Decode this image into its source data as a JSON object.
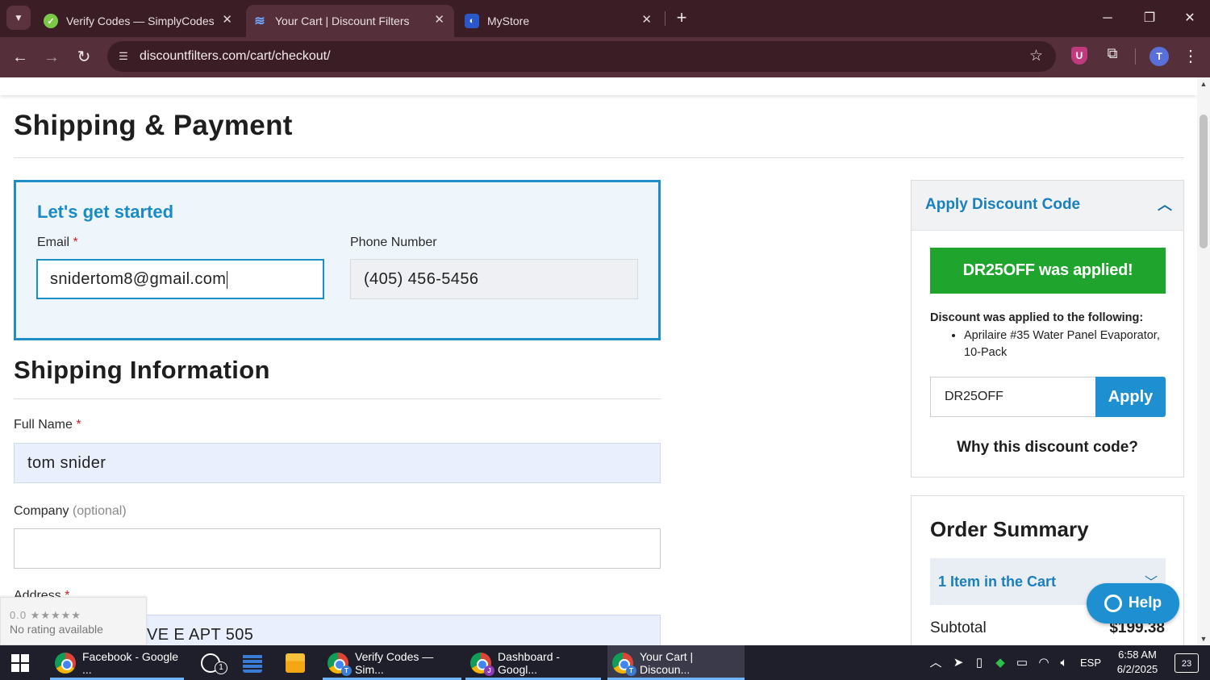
{
  "browser": {
    "tabs": [
      {
        "title": "Verify Codes — SimplyCodes",
        "icon": "simplycodes-favicon"
      },
      {
        "title": "Your Cart | Discount Filters",
        "icon": "discountfilters-favicon"
      },
      {
        "title": "MyStore",
        "icon": "mystore-favicon"
      }
    ],
    "url": "discountfilters.com/cart/checkout/",
    "profile_initial": "T",
    "extension_label": "U"
  },
  "page": {
    "title": "Shipping & Payment",
    "start": {
      "heading": "Let's get started",
      "email_label": "Email",
      "email_value": "snidertom8@gmail.com",
      "phone_label": "Phone Number",
      "phone_value": "(405) 456-5456"
    },
    "shipping": {
      "heading": "Shipping Information",
      "full_name_label": "Full Name",
      "full_name_value": "tom snider",
      "company_label": "Company",
      "company_optional": "(optional)",
      "company_value": "",
      "address_label": "Address",
      "address_value": "VE E APT 505"
    },
    "required_mark": "*",
    "discount": {
      "heading": "Apply Discount Code",
      "banner": "DR25OFF was applied!",
      "applied_to_label": "Discount was applied to the following:",
      "items": [
        "Aprilaire #35 Water Panel Evaporator, 10-Pack"
      ],
      "code_value": "DR25OFF",
      "apply_label": "Apply",
      "why_link": "Why this discount code?"
    },
    "order_summary": {
      "heading": "Order Summary",
      "cart_label": "1 Item in the Cart",
      "subtotal_label": "Subtotal",
      "subtotal_value": "$199.38"
    },
    "help_label": "Help",
    "rating": {
      "score": "0.0 ★★★★★",
      "text": "No rating available"
    }
  },
  "taskbar": {
    "apps": [
      {
        "label": "Facebook - Google ...",
        "icon": "chrome-icon"
      },
      {
        "label": "",
        "icon": "whatsapp-icon",
        "badge": "1"
      },
      {
        "label": "",
        "icon": "calculator-icon"
      },
      {
        "label": "",
        "icon": "file-explorer-icon"
      },
      {
        "label": "Verify Codes — Sim...",
        "icon": "chrome-icon"
      },
      {
        "label": "Dashboard - Googl...",
        "icon": "chrome-icon"
      },
      {
        "label": "Your Cart | Discoun...",
        "icon": "chrome-icon"
      }
    ],
    "language": "ESP",
    "time": "6:58 AM",
    "date": "6/2/2025",
    "notifications": "23"
  },
  "colors": {
    "accent_blue": "#1e8fc6",
    "success_green": "#1fa52e",
    "titlebar": "#3b1d26",
    "toolbar": "#55303b"
  }
}
